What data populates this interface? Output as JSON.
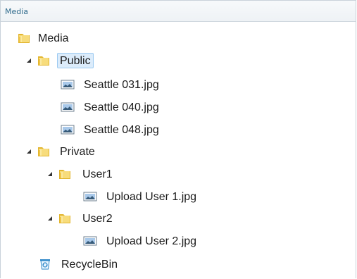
{
  "panel": {
    "title": "Media"
  },
  "tree": {
    "nodes": [
      {
        "label": "Media",
        "icon": "folder-icon",
        "expander": "none"
      },
      {
        "label": "Public",
        "icon": "folder-icon",
        "expander": "expanded",
        "selected": true
      },
      {
        "label": "Seattle 031.jpg",
        "icon": "image-file-icon",
        "expander": "none"
      },
      {
        "label": "Seattle 040.jpg",
        "icon": "image-file-icon",
        "expander": "none"
      },
      {
        "label": "Seattle 048.jpg",
        "icon": "image-file-icon",
        "expander": "none"
      },
      {
        "label": "Private",
        "icon": "folder-icon",
        "expander": "expanded"
      },
      {
        "label": "User1",
        "icon": "folder-icon",
        "expander": "expanded"
      },
      {
        "label": "Upload User 1.jpg",
        "icon": "image-file-icon",
        "expander": "none"
      },
      {
        "label": "User2",
        "icon": "folder-icon",
        "expander": "expanded"
      },
      {
        "label": "Upload User 2.jpg",
        "icon": "image-file-icon",
        "expander": "none"
      },
      {
        "label": "RecycleBin",
        "icon": "recycle-bin-icon",
        "expander": "none"
      }
    ]
  },
  "colors": {
    "header_text": "#2f6a8c",
    "selection_fill": "#dcecfb",
    "selection_border": "#9ccaf1",
    "folder": "#f2c94c",
    "border": "#c9d2da"
  }
}
